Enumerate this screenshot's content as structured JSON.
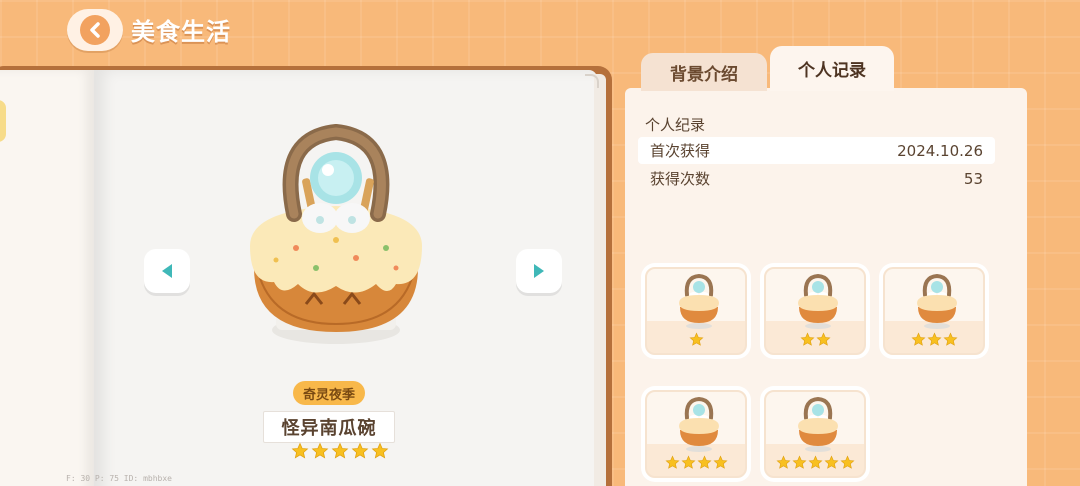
{
  "header": {
    "title": "美食生活",
    "back_icon": "chevron-left-icon"
  },
  "item": {
    "season_tag": "奇灵夜季",
    "name": "怪异南瓜碗",
    "stars": 5
  },
  "debug_text": "F: 30    P: 75    ID: mbhbxe",
  "tabs": [
    {
      "label": "背景介绍",
      "active": false
    },
    {
      "label": "个人记录",
      "active": true
    }
  ],
  "record": {
    "title": "个人纪录",
    "rows": [
      {
        "label": "首次获得",
        "value": "2024.10.26"
      },
      {
        "label": "获得次数",
        "value": "53"
      }
    ]
  },
  "variants": [
    {
      "stars": 1
    },
    {
      "stars": 2
    },
    {
      "stars": 3
    },
    {
      "stars": 4
    },
    {
      "stars": 5
    }
  ],
  "colors": {
    "background": "#f8b97a",
    "accent_teal": "#3fb8b8",
    "star": "#f8c020",
    "tag": "#f8b84a"
  }
}
